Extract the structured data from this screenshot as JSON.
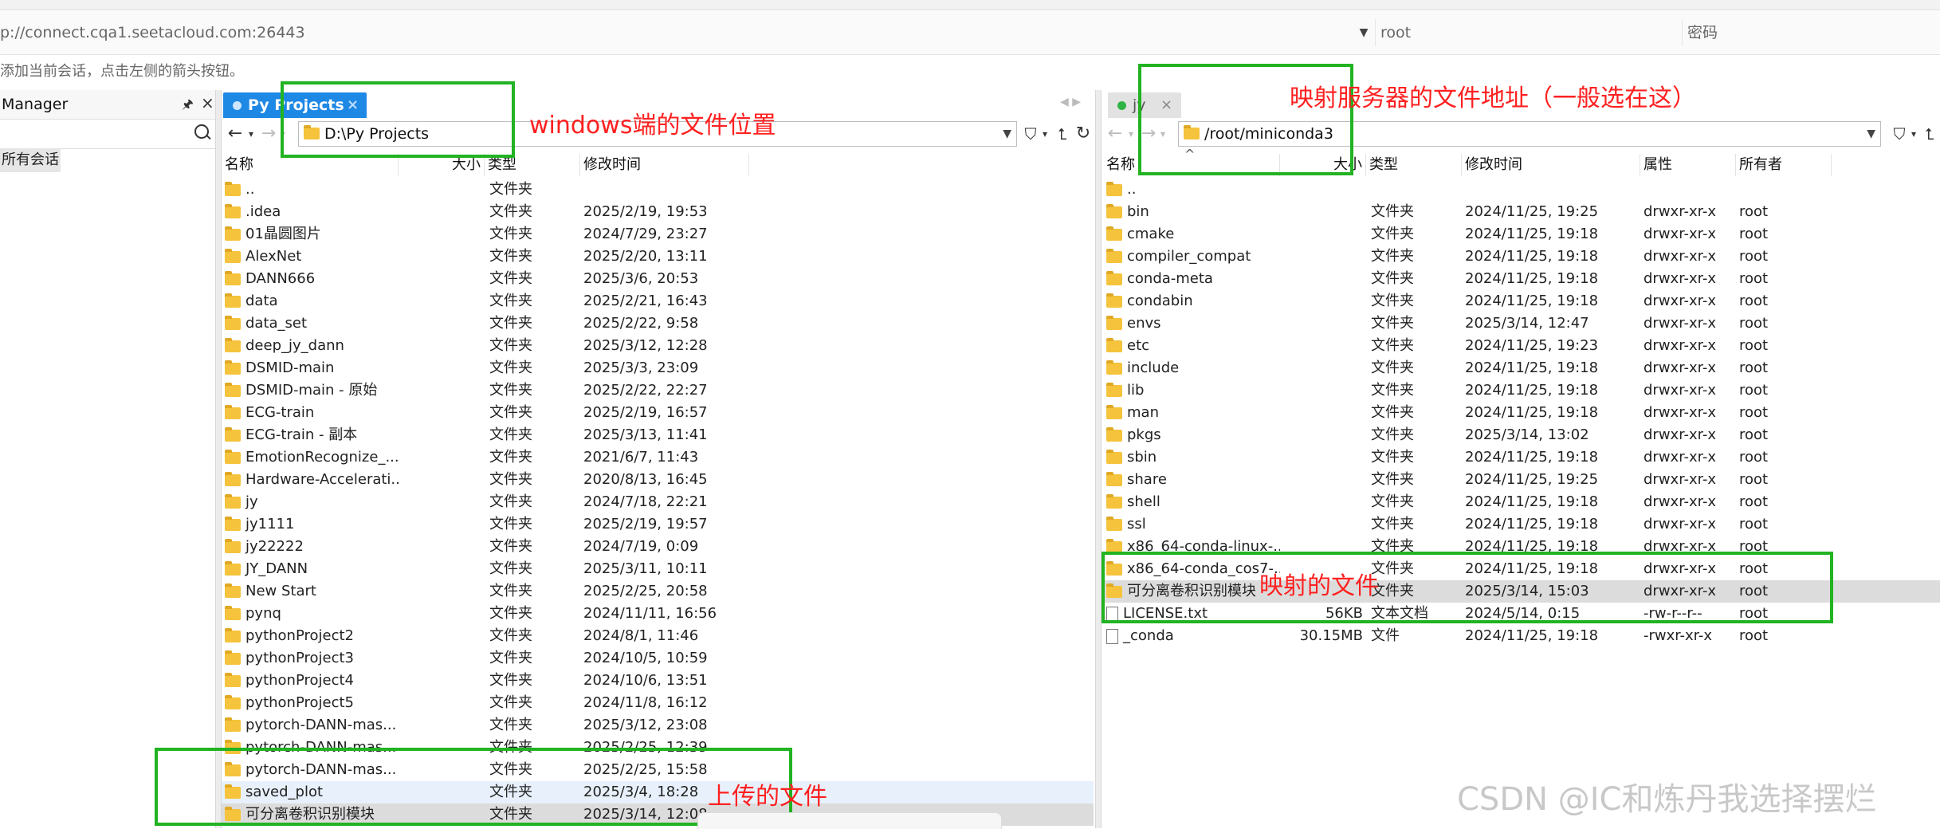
{
  "connection": {
    "url": "p://connect.cqa1.seetacloud.com:26443",
    "username": "root",
    "password_placeholder": "密码",
    "hint": "添加当前会话，点击左侧的箭头按钮。"
  },
  "session_manager": {
    "title": "Manager",
    "item": "所有会话"
  },
  "local_pane": {
    "tab_label": "Py Projects",
    "tab_color": "#1e88e5",
    "address": "D:\\Py Projects",
    "columns": [
      "名称",
      "大小",
      "类型",
      "修改时间"
    ],
    "rows": [
      {
        "name": "..",
        "size": "",
        "type": "文件夹",
        "modified": ""
      },
      {
        "name": ".idea",
        "size": "",
        "type": "文件夹",
        "modified": "2025/2/19, 19:53"
      },
      {
        "name": "01晶圆图片",
        "size": "",
        "type": "文件夹",
        "modified": "2024/7/29, 23:27"
      },
      {
        "name": "AlexNet",
        "size": "",
        "type": "文件夹",
        "modified": "2025/2/20, 13:11"
      },
      {
        "name": "DANN666",
        "size": "",
        "type": "文件夹",
        "modified": "2025/3/6, 20:53"
      },
      {
        "name": "data",
        "size": "",
        "type": "文件夹",
        "modified": "2025/2/21, 16:43"
      },
      {
        "name": "data_set",
        "size": "",
        "type": "文件夹",
        "modified": "2025/2/22, 9:58"
      },
      {
        "name": "deep_jy_dann",
        "size": "",
        "type": "文件夹",
        "modified": "2025/3/12, 12:28"
      },
      {
        "name": "DSMID-main",
        "size": "",
        "type": "文件夹",
        "modified": "2025/3/3, 23:09"
      },
      {
        "name": "DSMID-main - 原始",
        "size": "",
        "type": "文件夹",
        "modified": "2025/2/22, 22:27"
      },
      {
        "name": "ECG-train",
        "size": "",
        "type": "文件夹",
        "modified": "2025/2/19, 16:57"
      },
      {
        "name": "ECG-train - 副本",
        "size": "",
        "type": "文件夹",
        "modified": "2025/3/13, 11:41"
      },
      {
        "name": "EmotionRecognize_...",
        "size": "",
        "type": "文件夹",
        "modified": "2021/6/7, 11:43"
      },
      {
        "name": "Hardware-Accelerati...",
        "size": "",
        "type": "文件夹",
        "modified": "2020/8/13, 16:45"
      },
      {
        "name": "jy",
        "size": "",
        "type": "文件夹",
        "modified": "2024/7/18, 22:21"
      },
      {
        "name": "jy1111",
        "size": "",
        "type": "文件夹",
        "modified": "2025/2/19, 19:57"
      },
      {
        "name": "jy22222",
        "size": "",
        "type": "文件夹",
        "modified": "2024/7/19, 0:09"
      },
      {
        "name": "JY_DANN",
        "size": "",
        "type": "文件夹",
        "modified": "2025/3/11, 10:11"
      },
      {
        "name": "New Start",
        "size": "",
        "type": "文件夹",
        "modified": "2025/2/25, 20:58"
      },
      {
        "name": "pynq",
        "size": "",
        "type": "文件夹",
        "modified": "2024/11/11, 16:56"
      },
      {
        "name": "pythonProject2",
        "size": "",
        "type": "文件夹",
        "modified": "2024/8/1, 11:46"
      },
      {
        "name": "pythonProject3",
        "size": "",
        "type": "文件夹",
        "modified": "2024/10/5, 10:59"
      },
      {
        "name": "pythonProject4",
        "size": "",
        "type": "文件夹",
        "modified": "2024/10/6, 13:51"
      },
      {
        "name": "pythonProject5",
        "size": "",
        "type": "文件夹",
        "modified": "2024/11/8, 16:12"
      },
      {
        "name": "pytorch-DANN-mas...",
        "size": "",
        "type": "文件夹",
        "modified": "2025/3/12, 23:08"
      },
      {
        "name": "pytorch-DANN-mas...",
        "size": "",
        "type": "文件夹",
        "modified": "2025/2/25, 12:39"
      },
      {
        "name": "pytorch-DANN-mas...",
        "size": "",
        "type": "文件夹",
        "modified": "2025/2/25, 15:58"
      },
      {
        "name": "saved_plot",
        "size": "",
        "type": "文件夹",
        "modified": "2025/3/4, 18:28"
      },
      {
        "name": "可分离卷积识别模块",
        "size": "",
        "type": "文件夹",
        "modified": "2025/3/14, 12:08"
      }
    ]
  },
  "remote_pane": {
    "tab_label": "jy",
    "tab_color": "#2fb344",
    "address": "/root/miniconda3",
    "columns": [
      "名称",
      "大小",
      "类型",
      "修改时间",
      "属性",
      "所有者"
    ],
    "rows": [
      {
        "name": "..",
        "size": "",
        "type": "",
        "modified": "",
        "perm": "",
        "owner": "",
        "icon": "folder"
      },
      {
        "name": "bin",
        "size": "",
        "type": "文件夹",
        "modified": "2024/11/25, 19:25",
        "perm": "drwxr-xr-x",
        "owner": "root",
        "icon": "folder"
      },
      {
        "name": "cmake",
        "size": "",
        "type": "文件夹",
        "modified": "2024/11/25, 19:18",
        "perm": "drwxr-xr-x",
        "owner": "root",
        "icon": "folder"
      },
      {
        "name": "compiler_compat",
        "size": "",
        "type": "文件夹",
        "modified": "2024/11/25, 19:18",
        "perm": "drwxr-xr-x",
        "owner": "root",
        "icon": "folder"
      },
      {
        "name": "conda-meta",
        "size": "",
        "type": "文件夹",
        "modified": "2024/11/25, 19:18",
        "perm": "drwxr-xr-x",
        "owner": "root",
        "icon": "folder"
      },
      {
        "name": "condabin",
        "size": "",
        "type": "文件夹",
        "modified": "2024/11/25, 19:18",
        "perm": "drwxr-xr-x",
        "owner": "root",
        "icon": "folder"
      },
      {
        "name": "envs",
        "size": "",
        "type": "文件夹",
        "modified": "2025/3/14, 12:47",
        "perm": "drwxr-xr-x",
        "owner": "root",
        "icon": "folder"
      },
      {
        "name": "etc",
        "size": "",
        "type": "文件夹",
        "modified": "2024/11/25, 19:23",
        "perm": "drwxr-xr-x",
        "owner": "root",
        "icon": "folder"
      },
      {
        "name": "include",
        "size": "",
        "type": "文件夹",
        "modified": "2024/11/25, 19:18",
        "perm": "drwxr-xr-x",
        "owner": "root",
        "icon": "folder"
      },
      {
        "name": "lib",
        "size": "",
        "type": "文件夹",
        "modified": "2024/11/25, 19:18",
        "perm": "drwxr-xr-x",
        "owner": "root",
        "icon": "folder"
      },
      {
        "name": "man",
        "size": "",
        "type": "文件夹",
        "modified": "2024/11/25, 19:18",
        "perm": "drwxr-xr-x",
        "owner": "root",
        "icon": "folder"
      },
      {
        "name": "pkgs",
        "size": "",
        "type": "文件夹",
        "modified": "2025/3/14, 13:02",
        "perm": "drwxr-xr-x",
        "owner": "root",
        "icon": "folder"
      },
      {
        "name": "sbin",
        "size": "",
        "type": "文件夹",
        "modified": "2024/11/25, 19:18",
        "perm": "drwxr-xr-x",
        "owner": "root",
        "icon": "folder"
      },
      {
        "name": "share",
        "size": "",
        "type": "文件夹",
        "modified": "2024/11/25, 19:25",
        "perm": "drwxr-xr-x",
        "owner": "root",
        "icon": "folder"
      },
      {
        "name": "shell",
        "size": "",
        "type": "文件夹",
        "modified": "2024/11/25, 19:18",
        "perm": "drwxr-xr-x",
        "owner": "root",
        "icon": "folder"
      },
      {
        "name": "ssl",
        "size": "",
        "type": "文件夹",
        "modified": "2024/11/25, 19:18",
        "perm": "drwxr-xr-x",
        "owner": "root",
        "icon": "folder"
      },
      {
        "name": "x86_64-conda-linux-...",
        "size": "",
        "type": "文件夹",
        "modified": "2024/11/25, 19:18",
        "perm": "drwxr-xr-x",
        "owner": "root",
        "icon": "folder"
      },
      {
        "name": "x86_64-conda_cos7-...",
        "size": "",
        "type": "文件夹",
        "modified": "2024/11/25, 19:18",
        "perm": "drwxr-xr-x",
        "owner": "root",
        "icon": "folder"
      },
      {
        "name": "可分离卷积识别模块",
        "size": "",
        "type": "文件夹",
        "modified": "2025/3/14, 15:03",
        "perm": "drwxr-xr-x",
        "owner": "root",
        "icon": "folder"
      },
      {
        "name": "LICENSE.txt",
        "size": "56KB",
        "type": "文本文档",
        "modified": "2024/5/14, 0:15",
        "perm": "-rw-r--r--",
        "owner": "root",
        "icon": "file"
      },
      {
        "name": "_conda",
        "size": "30.15MB",
        "type": "文件",
        "modified": "2024/11/25, 19:18",
        "perm": "-rwxr-xr-x",
        "owner": "root",
        "icon": "file"
      }
    ]
  },
  "annotations": {
    "local_path": "windows端的文件位置",
    "remote_path": "映射服务器的文件地址（一般选在这）",
    "mapped_file": "映射的文件",
    "uploaded_file": "上传的文件",
    "box_color": "#22b322",
    "text_color": "#ff2020"
  },
  "watermark": "CSDN @IC和炼丹我选择摆烂"
}
